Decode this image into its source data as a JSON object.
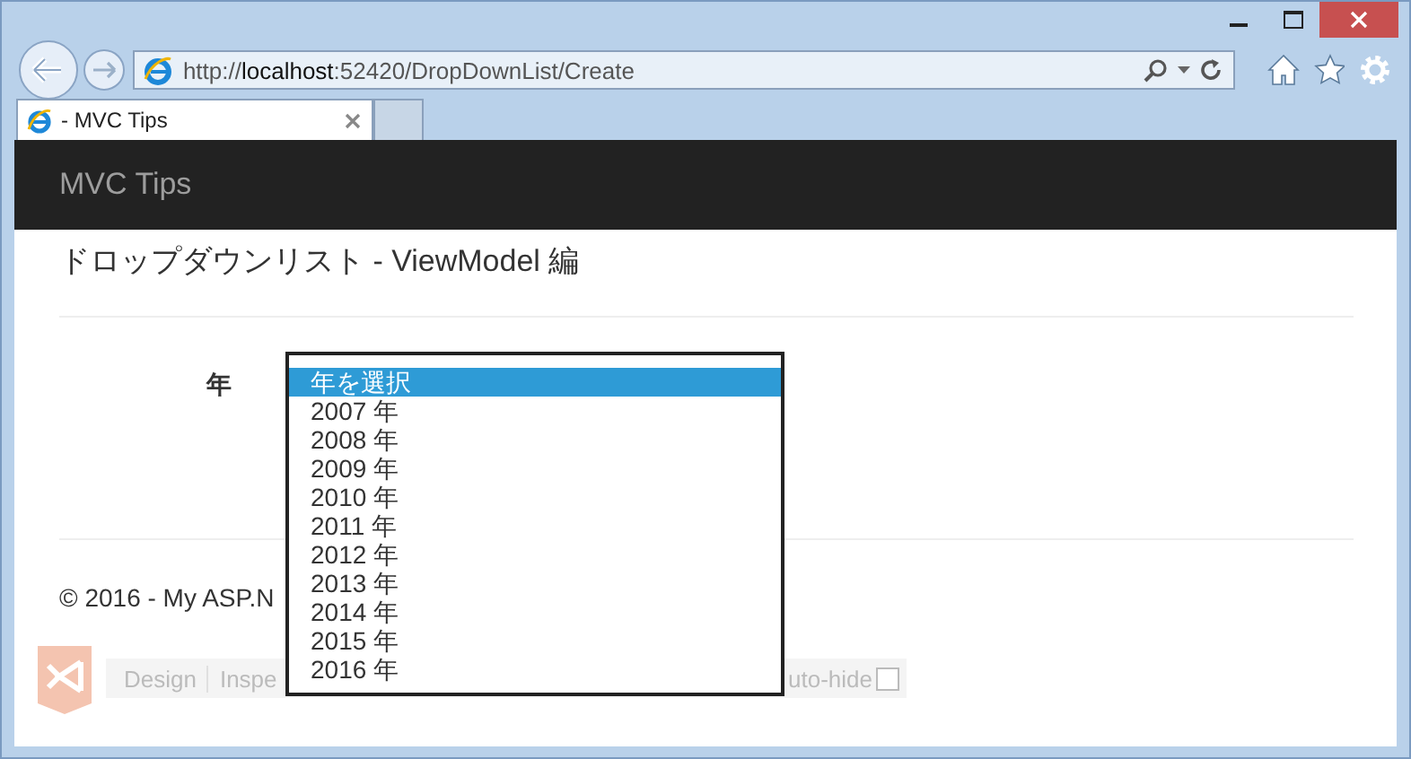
{
  "browser": {
    "url_prefix": "http://",
    "url_host": "localhost",
    "url_rest": ":52420/DropDownList/Create",
    "tab_title": "- MVC Tips"
  },
  "navbar": {
    "brand": "MVC Tips"
  },
  "page": {
    "heading": "ドロップダウンリスト - ViewModel 編",
    "field_label": "年",
    "dropdown": {
      "expanded": true,
      "options": [
        {
          "label": "年を選択",
          "selected": true
        },
        {
          "label": "2007 年",
          "selected": false
        },
        {
          "label": "2008 年",
          "selected": false
        },
        {
          "label": "2009 年",
          "selected": false
        },
        {
          "label": "2010 年",
          "selected": false
        },
        {
          "label": "2011 年",
          "selected": false
        },
        {
          "label": "2012 年",
          "selected": false
        },
        {
          "label": "2013 年",
          "selected": false
        },
        {
          "label": "2014 年",
          "selected": false
        },
        {
          "label": "2015 年",
          "selected": false
        },
        {
          "label": "2016 年",
          "selected": false
        }
      ]
    }
  },
  "footer": {
    "text": "© 2016 - My ASP.N"
  },
  "browser_link": {
    "buttons": [
      "Design",
      "Inspe"
    ],
    "auto_hide_label": "uto-hide",
    "auto_hide_checked": false
  }
}
